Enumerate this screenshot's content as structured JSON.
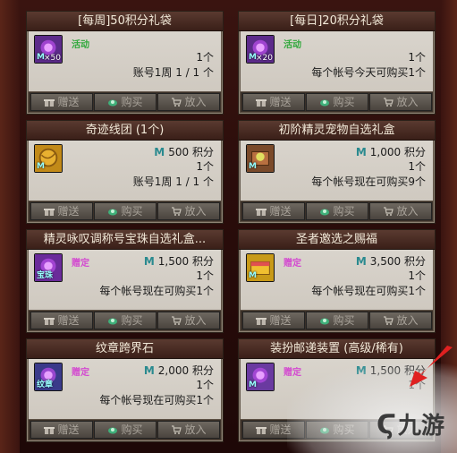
{
  "labels": {
    "gift": "赠送",
    "buy": "购买",
    "cart": "放入",
    "activity": "活动",
    "bound": "赠定",
    "points_unit": "积分",
    "m": "M"
  },
  "cards": [
    {
      "title": "[每周]50积分礼袋",
      "tag": "活动",
      "icon_name": "weekly-gift-bag-icon",
      "icon_color": "#5c2b8a",
      "icon_qty": "×50",
      "icon_m": "M",
      "price": "",
      "line1": "1个",
      "line2": "账号1周 1 / 1 个"
    },
    {
      "title": "[每日]20积分礼袋",
      "tag": "活动",
      "icon_name": "daily-gift-bag-icon",
      "icon_color": "#5c2b8a",
      "icon_qty": "×20",
      "icon_m": "M",
      "price": "",
      "line1": "1个",
      "line2": "每个帐号今天可购买1个"
    },
    {
      "title": "奇迹线团 (1个)",
      "tag": "",
      "icon_name": "miracle-yarn-icon",
      "icon_color": "#c28a18",
      "icon_qty": "",
      "icon_m": "M",
      "price": "500",
      "line1": "1个",
      "line2": "账号1周 1 / 1 个"
    },
    {
      "title": "初阶精灵宠物自选礼盒",
      "tag": "",
      "icon_name": "pet-gift-box-icon",
      "icon_color": "#7a4a2a",
      "icon_qty": "",
      "icon_m": "M",
      "price": "1,000",
      "line1": "1个",
      "line2": "每个帐号现在可购买9个"
    },
    {
      "title": "精灵咏叹调称号宝珠自选礼盒...",
      "tag": "赠定",
      "icon_name": "title-orb-box-icon",
      "icon_color": "#6a2b9a",
      "icon_qty": "",
      "icon_m": "宝珠",
      "price": "1,500",
      "line1": "1个",
      "line2": "每个帐号现在可购买1个"
    },
    {
      "title": "圣者邀选之赐福",
      "tag": "赠定",
      "icon_name": "blessing-chest-icon",
      "icon_color": "#c89a18",
      "icon_qty": "",
      "icon_m": "M",
      "price": "3,500",
      "line1": "1个",
      "line2": "每个帐号现在可购买1个"
    },
    {
      "title": "纹章跨界石",
      "tag": "赠定",
      "icon_name": "emblem-stone-icon",
      "icon_color": "#3a3a8a",
      "icon_qty": "",
      "icon_m": "纹章",
      "price": "2,000",
      "line1": "1个",
      "line2": "每个帐号现在可购买1个"
    },
    {
      "title": "装扮邮递装置 (高级/稀有)",
      "tag": "赠定",
      "icon_name": "costume-mail-device-icon",
      "icon_color": "#6a3aa0",
      "icon_qty": "",
      "icon_m": "M",
      "price": "1,500",
      "line1": "1个",
      "line2": ""
    }
  ],
  "watermark": "九游"
}
